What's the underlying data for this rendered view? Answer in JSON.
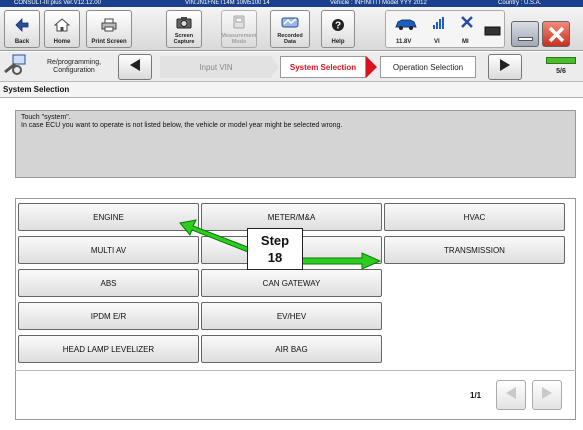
{
  "titlebar": {
    "app": "CONSULT-III plus  Ver.V12.12.00",
    "vin": "VIN:JN1FNET14M 10M5100 14",
    "vehicle": "Vehicle : INFINITI I Model YYY 2012",
    "country": "Country : U.S.A."
  },
  "toolbar": {
    "back": "Back",
    "home": "Home",
    "print_screen": "Print Screen",
    "screen_capture": "Screen Capture",
    "measurement_mode": "Measurement Mode",
    "recorded_data": "Recorded Data",
    "help": "Help",
    "voltage": "11.8V",
    "vi": "VI",
    "mi": "MI"
  },
  "nav": {
    "reprogramming": "Re/programming, Configuration",
    "input_vin": "Input VIN",
    "system_selection": "System Selection",
    "operation_selection": "Operation Selection",
    "page": "5/6"
  },
  "section_title": "System Selection",
  "message": {
    "line1": "Touch \"system\".",
    "line2": "In case ECU you want to operate is not listed below, the vehicle or model year might be selected wrong."
  },
  "systems": [
    "ENGINE",
    "METER/M&A",
    "HVAC",
    "MULTI AV",
    "",
    "TRANSMISSION",
    "ABS",
    "CAN GATEWAY",
    "IPDM E/R",
    "EV/HEV",
    "HEAD LAMP LEVELIZER",
    "AIR BAG"
  ],
  "pagination": "1/1",
  "callout": {
    "line1": "Step",
    "line2": "18"
  },
  "colors": {
    "active_crumb": "#d8141e",
    "arrow": "#2ecc1f",
    "titlebar": "#1a3f8c"
  }
}
